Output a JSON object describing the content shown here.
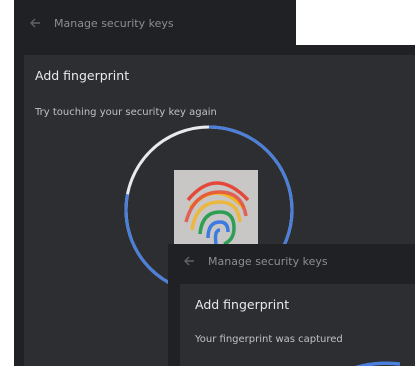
{
  "window_top": {
    "header": {
      "title": "Manage security keys",
      "back_icon": "back-arrow-icon"
    }
  },
  "window_main": {
    "dialog": {
      "title": "Add fingerprint",
      "message": "Try touching your security key again",
      "progress_fraction": 0.78,
      "icon": "fingerprint-icon"
    }
  },
  "window_captured": {
    "header": {
      "title": "Manage security keys",
      "back_icon": "back-arrow-icon"
    },
    "dialog": {
      "title": "Add fingerprint",
      "message": "Your fingerprint was captured"
    }
  },
  "colors": {
    "window_bg": "#202124",
    "dialog_bg": "#2d2e31",
    "progress": "#4a7fdc",
    "progress_track": "#e8eaed"
  }
}
